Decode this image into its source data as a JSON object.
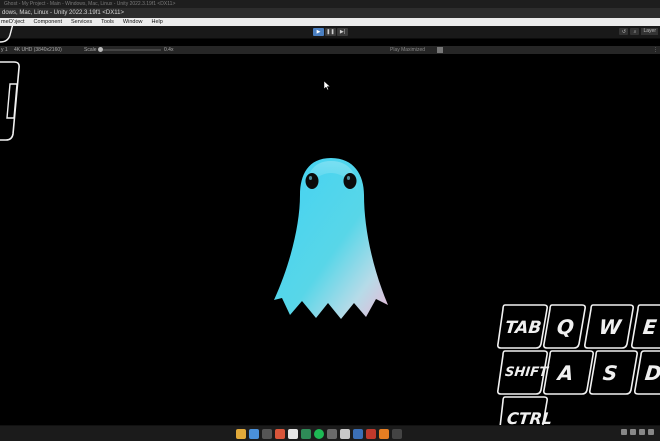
{
  "window": {
    "title": "Ghost - My Project - Main - Windows, Mac, Linux - Unity 2022.3.19f1 <DX11>"
  },
  "editor": {
    "title": "dows, Mac, Linux - Unity 2022.3.19f1 <DX11>"
  },
  "menu": {
    "items": [
      "meObject",
      "Component",
      "Services",
      "Tools",
      "Window",
      "Help"
    ]
  },
  "toolbar": {
    "play_icon": "▶",
    "pause_icon": "❚❚",
    "step_icon": "▶|",
    "layers_label": "Layer"
  },
  "gameview": {
    "display": "y 1",
    "resolution": "4K UHD (3840x2160)",
    "scale_label": "Scale",
    "scale_value": "0.4x",
    "play_mode": "Play Maximized",
    "menu_icon": "⋮"
  },
  "keyboard": {
    "keys": [
      "TAB",
      "Q",
      "W",
      "E",
      "SHIFT",
      "A",
      "S",
      "D",
      "CTRL"
    ]
  },
  "icons": {
    "cursor": "mouse-pointer-icon",
    "ghost": "ghost-model"
  },
  "colors": {
    "ghost_cyan": "#3ed0f0",
    "ghost_pink": "#e8bcd8",
    "play_active": "#4a7fc1"
  }
}
